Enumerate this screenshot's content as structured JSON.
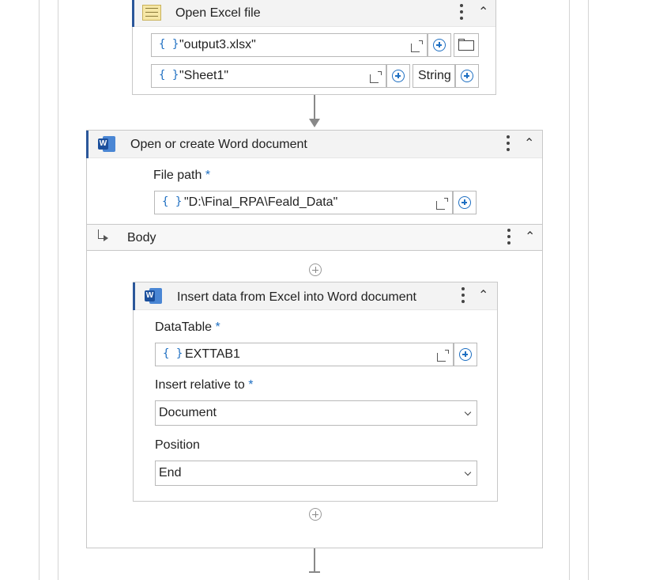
{
  "excel_activity": {
    "title": "Open Excel file",
    "file_value": "\"output3.xlsx\"",
    "sheet_value": "\"Sheet1\"",
    "type_value": "String",
    "icon": "excel-file-icon"
  },
  "word_activity": {
    "title": "Open or create Word document",
    "file_path_label": "File path",
    "required_mark": "*",
    "file_path_value": "\"D:\\Final_RPA\\Feald_Data\"",
    "icon": "word-icon"
  },
  "body_section": {
    "title": "Body"
  },
  "insert_activity": {
    "title": "Insert data from Excel into Word document",
    "datatable_label": "DataTable",
    "datatable_value": "EXTTAB1",
    "insert_relative_label": "Insert relative to",
    "insert_relative_value": "Document",
    "position_label": "Position",
    "position_value": "End",
    "required_mark": "*",
    "icon": "word-icon"
  },
  "common": {
    "brace": "{ }",
    "word_letter": "W"
  },
  "colors": {
    "accent": "#2b579a",
    "link_blue": "#1e6fc2",
    "border": "#c8c8c8",
    "header_bg": "#f3f3f3"
  }
}
